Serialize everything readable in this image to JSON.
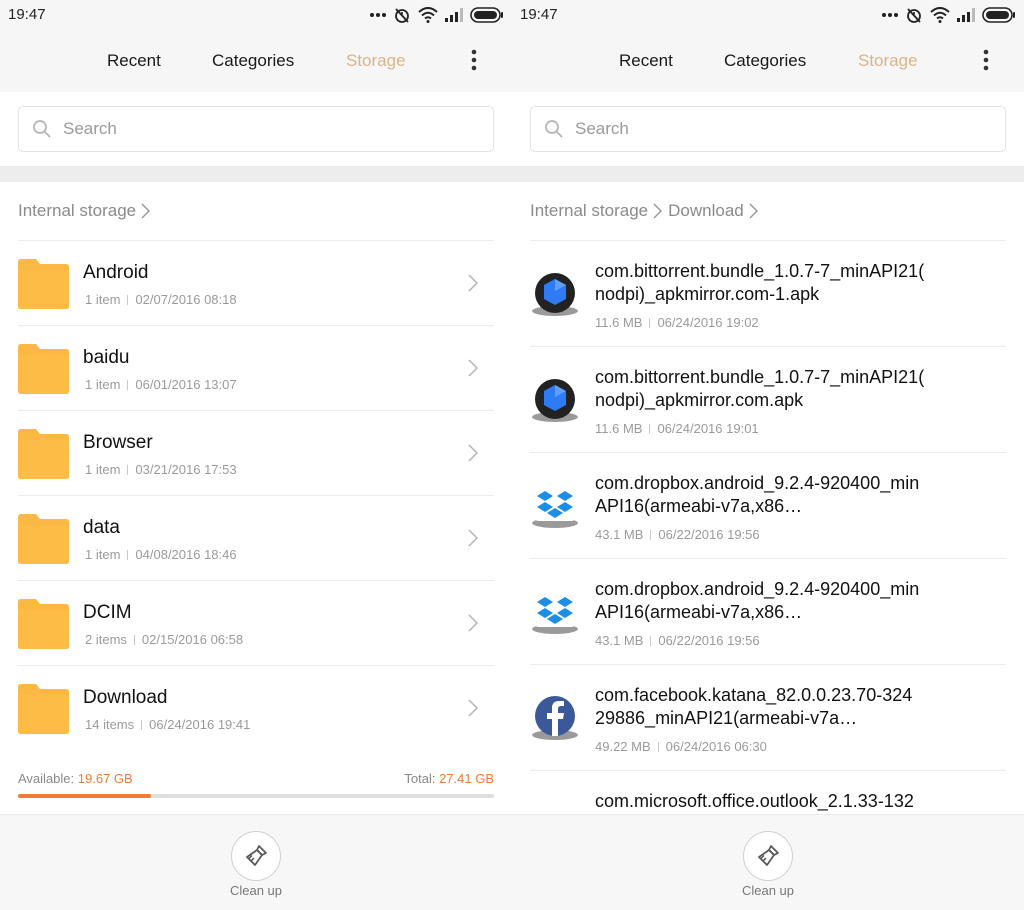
{
  "status_bar": {
    "time": "19:47"
  },
  "tabs": {
    "recent": "Recent",
    "categories": "Categories",
    "storage": "Storage"
  },
  "search": {
    "placeholder": "Search"
  },
  "colors": {
    "accent_tab": "#d9b48a",
    "storage_orange": "#f07c33",
    "folder": "#fbb943"
  },
  "left": {
    "breadcrumb": [
      "Internal storage"
    ],
    "folders": [
      {
        "name": "Android",
        "items": "1 item",
        "date": "02/07/2016 08:18"
      },
      {
        "name": "baidu",
        "items": "1 item",
        "date": "06/01/2016 13:07"
      },
      {
        "name": "Browser",
        "items": "1 item",
        "date": "03/21/2016 17:53"
      },
      {
        "name": "data",
        "items": "1 item",
        "date": "04/08/2016 18:46"
      },
      {
        "name": "DCIM",
        "items": "2 items",
        "date": "02/15/2016 06:58"
      },
      {
        "name": "Download",
        "items": "14 items",
        "date": "06/24/2016 19:41"
      }
    ],
    "storage": {
      "available_label": "Available:",
      "available_value": "19.67 GB",
      "total_label": "Total:",
      "total_value": "27.41 GB",
      "used_fraction": 0.28
    }
  },
  "right": {
    "breadcrumb": [
      "Internal storage",
      "Download"
    ],
    "files": [
      {
        "icon": "bittorrent-icon",
        "title": "com.bittorrent.bundle_1.0.7-7_minAPI21(\nnodpi)_apkmirror.com-1.apk",
        "size": "11.6 MB",
        "date": "06/24/2016 19:02"
      },
      {
        "icon": "bittorrent-icon",
        "title": "com.bittorrent.bundle_1.0.7-7_minAPI21(\nnodpi)_apkmirror.com.apk",
        "size": "11.6 MB",
        "date": "06/24/2016 19:01"
      },
      {
        "icon": "dropbox-icon",
        "title": "com.dropbox.android_9.2.4-920400_min\nAPI16(armeabi-v7a,x86…",
        "size": "43.1 MB",
        "date": "06/22/2016 19:56"
      },
      {
        "icon": "dropbox-icon",
        "title": "com.dropbox.android_9.2.4-920400_min\nAPI16(armeabi-v7a,x86…",
        "size": "43.1 MB",
        "date": "06/22/2016 19:56"
      },
      {
        "icon": "facebook-icon",
        "title": "com.facebook.katana_82.0.0.23.70-324\n29886_minAPI21(armeabi-v7a…",
        "size": "49.22 MB",
        "date": "06/24/2016 06:30"
      },
      {
        "icon": "outlook-icon",
        "title": "com.microsoft.office.outlook_2.1.33-132",
        "size": "",
        "date": ""
      }
    ]
  },
  "footer": {
    "cleanup_label": "Clean up"
  }
}
